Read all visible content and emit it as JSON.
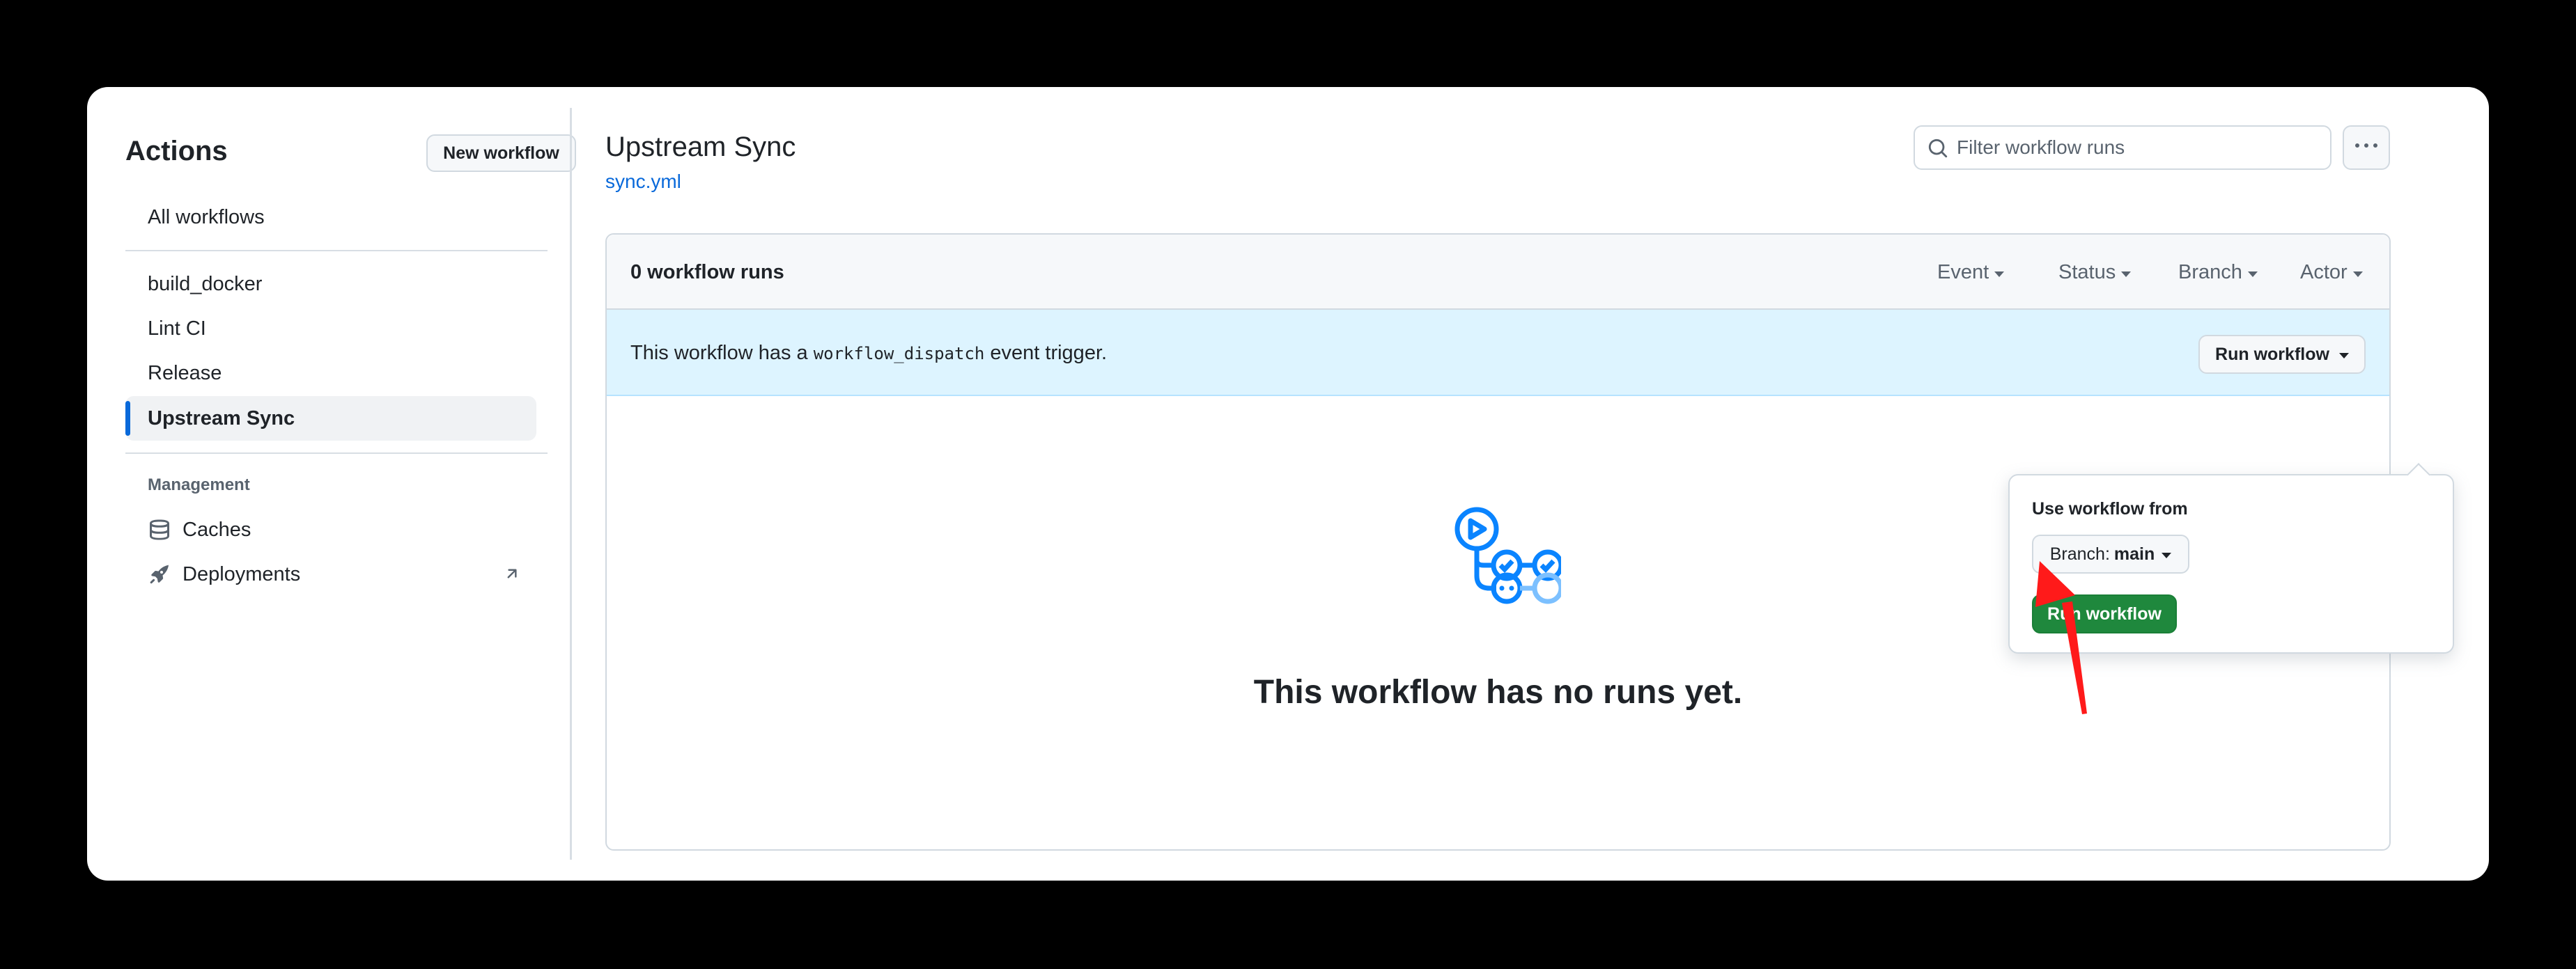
{
  "sidebar": {
    "title": "Actions",
    "new_workflow_label": "New workflow",
    "all_workflows_label": "All workflows",
    "workflows": [
      "build_docker",
      "Lint CI",
      "Release",
      "Upstream Sync"
    ],
    "active_workflow": "Upstream Sync",
    "management_label": "Management",
    "caches_label": "Caches",
    "deployments_label": "Deployments"
  },
  "main": {
    "title": "Upstream Sync",
    "file_link": "sync.yml",
    "filter_placeholder": "Filter workflow runs",
    "runs_count": "0 workflow runs",
    "filters": [
      "Event",
      "Status",
      "Branch",
      "Actor"
    ],
    "dispatch": {
      "prefix": "This workflow has a ",
      "code": "workflow_dispatch",
      "suffix": " event trigger.",
      "run_button_label": "Run workflow"
    },
    "empty_text": "This workflow has no runs yet."
  },
  "popover": {
    "label": "Use workflow from",
    "branch_prefix": "Branch:",
    "branch_value": "main",
    "run_button_label": "Run workflow"
  },
  "icons": {
    "caches": "database-icon",
    "deployments": "rocket-icon",
    "external": "arrow-up-right-icon",
    "filter": "search-icon",
    "more": "kebab-horizontal-icon",
    "empty": "workflow-graph-icon"
  },
  "colors": {
    "accent": "#0969da",
    "banner": "#ddf4ff",
    "primary_button": "#1f883d",
    "annotation_arrow": "#ff1a1a",
    "icon_blue": "#0a84ff"
  }
}
